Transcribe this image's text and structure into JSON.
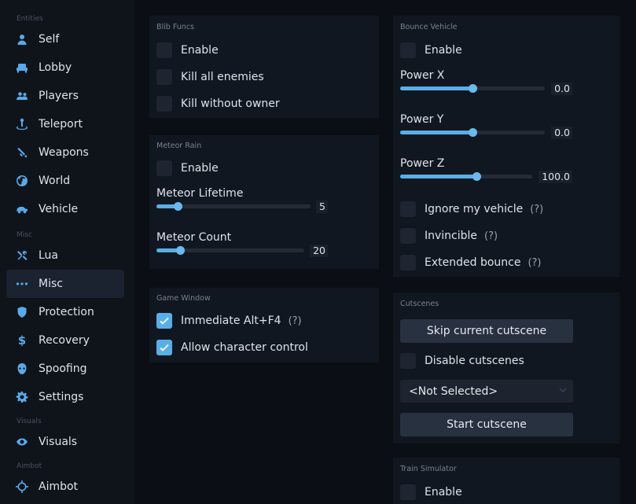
{
  "sidebar": {
    "sections": [
      {
        "label": "Entities",
        "items": [
          {
            "label": "Self",
            "icon": "person-icon"
          },
          {
            "label": "Lobby",
            "icon": "couch-icon"
          },
          {
            "label": "Players",
            "icon": "users-icon"
          },
          {
            "label": "Teleport",
            "icon": "teleport-icon"
          },
          {
            "label": "Weapons",
            "icon": "gun-icon"
          },
          {
            "label": "World",
            "icon": "globe-icon"
          },
          {
            "label": "Vehicle",
            "icon": "car-icon"
          }
        ]
      },
      {
        "label": "Misc",
        "items": [
          {
            "label": "Lua",
            "icon": "tools-icon"
          },
          {
            "label": "Misc",
            "icon": "ellipsis-icon",
            "active": true
          },
          {
            "label": "Protection",
            "icon": "shield-icon"
          },
          {
            "label": "Recovery",
            "icon": "dollar-icon"
          },
          {
            "label": "Spoofing",
            "icon": "mask-icon"
          },
          {
            "label": "Settings",
            "icon": "gear-icon"
          }
        ]
      },
      {
        "label": "Visuals",
        "items": [
          {
            "label": "Visuals",
            "icon": "eye-icon"
          }
        ]
      },
      {
        "label": "Aimbot",
        "items": [
          {
            "label": "Aimbot",
            "icon": "crosshair-icon"
          }
        ]
      }
    ]
  },
  "blib": {
    "title": "Blib Funcs",
    "enable": {
      "label": "Enable",
      "checked": false
    },
    "kill_all": {
      "label": "Kill all enemies",
      "checked": false
    },
    "kill_owner": {
      "label": "Kill without owner",
      "checked": false
    }
  },
  "meteor": {
    "title": "Meteor Rain",
    "enable": {
      "label": "Enable",
      "checked": false
    },
    "lifetime": {
      "label": "Meteor Lifetime",
      "value": "5",
      "fraction": 0.14
    },
    "count": {
      "label": "Meteor Count",
      "value": "20",
      "fraction": 0.16
    }
  },
  "game_window": {
    "title": "Game Window",
    "immediate": {
      "label": "Immediate Alt+F4",
      "help": "(?)",
      "checked": true
    },
    "allow_char": {
      "label": "Allow character control",
      "checked": true
    }
  },
  "bounce": {
    "title": "Bounce Vehicle",
    "enable": {
      "label": "Enable",
      "checked": false
    },
    "power_x": {
      "label": "Power X",
      "value": "0.0",
      "fraction": 0.5
    },
    "power_y": {
      "label": "Power Y",
      "value": "0.0",
      "fraction": 0.5
    },
    "power_z": {
      "label": "Power Z",
      "value": "100.0",
      "fraction": 0.58
    },
    "ignore": {
      "label": "Ignore my vehicle",
      "help": "(?)",
      "checked": false
    },
    "invincible": {
      "label": "Invincible",
      "help": "(?)",
      "checked": false
    },
    "extended": {
      "label": "Extended bounce",
      "help": "(?)",
      "checked": false
    }
  },
  "cutscenes": {
    "title": "Cutscenes",
    "skip_label": "Skip current cutscene",
    "disable": {
      "label": "Disable cutscenes",
      "checked": false
    },
    "select_value": "<Not Selected>",
    "start_label": "Start cutscene"
  },
  "train": {
    "title": "Train Simulator",
    "enable": {
      "label": "Enable",
      "checked": false
    }
  },
  "colors": {
    "accent": "#5aaee6",
    "panel": "#111720",
    "background": "#0b0f15"
  }
}
